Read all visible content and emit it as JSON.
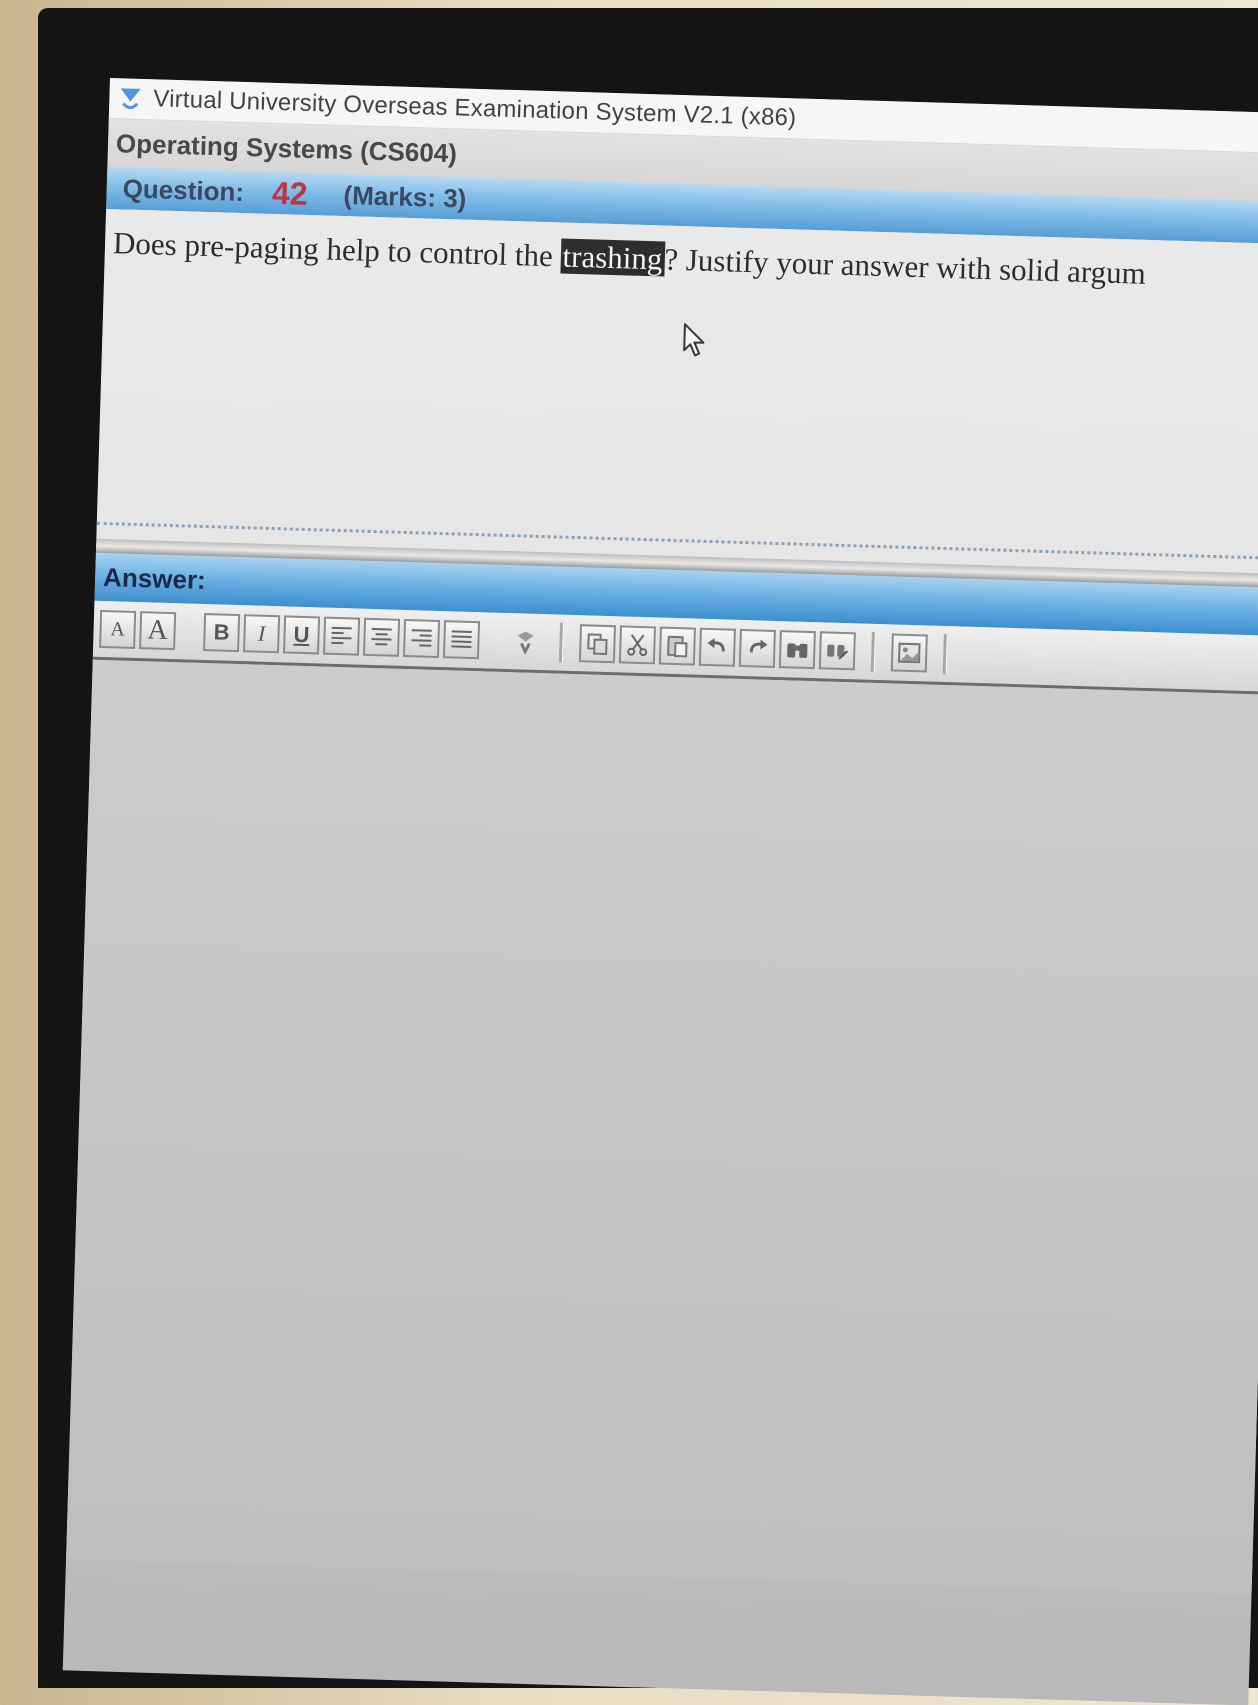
{
  "window": {
    "title": "Virtual University Overseas Examination System  V2.1 (x86)"
  },
  "course": {
    "name": "Operating Systems  (CS604)"
  },
  "question": {
    "label": "Question:",
    "number": "42",
    "marks": "(Marks: 3)",
    "text_before": "Does pre-paging help to control the ",
    "highlighted_word": "trashing",
    "text_after": "? Justify your answer with solid argum"
  },
  "answer": {
    "label": "Answer:",
    "value": ""
  },
  "toolbar": {
    "buttons": [
      {
        "name": "font-size-decrease-button",
        "glyph": "A"
      },
      {
        "name": "font-size-increase-button",
        "glyph": "A"
      },
      {
        "name": "bold-button",
        "glyph": "B"
      },
      {
        "name": "italic-button",
        "glyph": "I"
      },
      {
        "name": "underline-button",
        "glyph": "U"
      },
      {
        "name": "align-left-button",
        "icon": "align-left-icon"
      },
      {
        "name": "align-center-button",
        "icon": "align-center-icon"
      },
      {
        "name": "align-right-button",
        "icon": "align-right-icon"
      },
      {
        "name": "align-justify-button",
        "icon": "align-justify-icon"
      },
      {
        "name": "insert-symbol-button",
        "icon": "insert-symbol-icon"
      },
      {
        "name": "copy-button",
        "icon": "copy-icon"
      },
      {
        "name": "cut-button",
        "icon": "scissors-icon"
      },
      {
        "name": "paste-button",
        "icon": "paste-icon"
      },
      {
        "name": "undo-button",
        "icon": "undo-icon"
      },
      {
        "name": "redo-button",
        "icon": "redo-icon"
      },
      {
        "name": "find-button",
        "icon": "binoculars-icon"
      },
      {
        "name": "replace-button",
        "icon": "replace-icon"
      },
      {
        "name": "insert-image-button",
        "icon": "image-icon"
      }
    ]
  },
  "colors": {
    "header_blue": "#3e8fd0",
    "question_number": "#b1142a",
    "highlight_bg": "#111111"
  }
}
